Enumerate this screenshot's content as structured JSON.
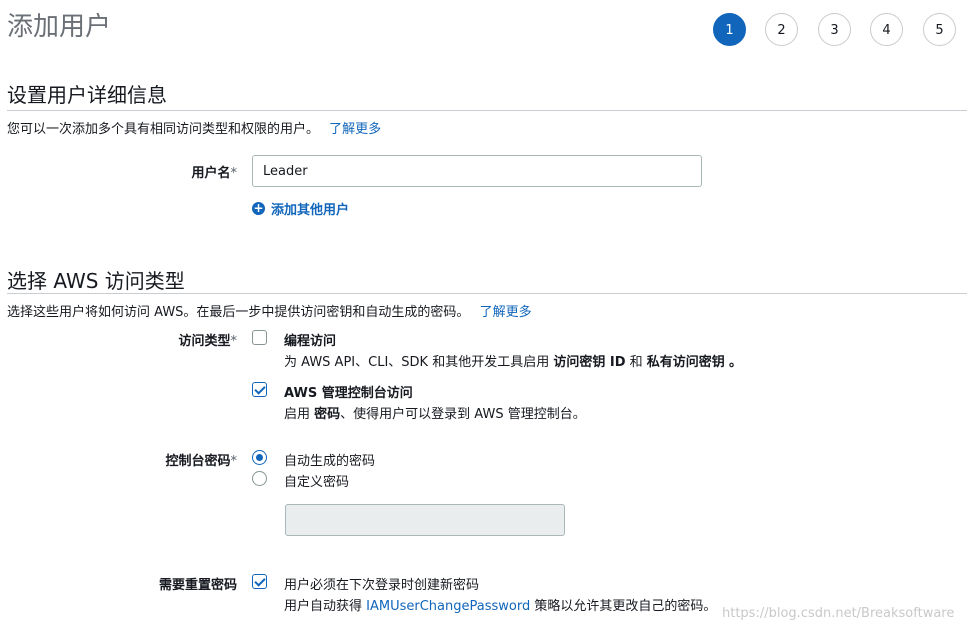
{
  "header": {
    "title": "添加用户"
  },
  "steps": [
    "1",
    "2",
    "3",
    "4",
    "5"
  ],
  "user_details": {
    "title": "设置用户详细信息",
    "description": "您可以一次添加多个具有相同访问类型和权限的用户。",
    "learn_more": "了解更多",
    "username_label": "用户名",
    "required_mark": "*",
    "username_value": "Leader",
    "add_user_label": "添加其他用户"
  },
  "access_type": {
    "title": "选择 AWS 访问类型",
    "description": "选择这些用户将如何访问 AWS。在最后一步中提供访问密钥和自动生成的密码。",
    "learn_more": "了解更多",
    "label": "访问类型",
    "required_mark": "*",
    "programmatic": {
      "title": "编程访问",
      "checked": false,
      "desc_prefix": "为 AWS API、CLI、SDK 和其他开发工具启用",
      "desc_bold1": "访问密钥 ID",
      "desc_mid": "和",
      "desc_bold2": "私有访问密钥",
      "desc_suffix": "。"
    },
    "console": {
      "title": "AWS 管理控制台访问",
      "checked": true,
      "desc_prefix": "启用",
      "desc_bold": "密码",
      "desc_suffix": "、使得用户可以登录到 AWS 管理控制台。"
    }
  },
  "console_password": {
    "label": "控制台密码",
    "required_mark": "*",
    "option_auto": "自动生成的密码",
    "option_custom": "自定义密码",
    "selected": "auto"
  },
  "reset_password": {
    "label": "需要重置密码",
    "checked": true,
    "text": "用户必须在下次登录时创建新密码",
    "desc_prefix": "用户自动获得",
    "policy_link": "IAMUserChangePassword",
    "desc_suffix": "策略以允许其更改自己的密码。"
  },
  "watermark": "https://blog.csdn.net/Breaksoftware",
  "colors": {
    "accent": "#1166bb",
    "border": "#aab7b8",
    "disabled_bg": "#eaeded"
  }
}
